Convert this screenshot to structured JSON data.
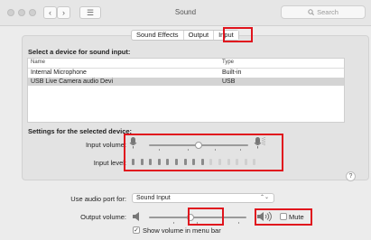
{
  "window": {
    "title": "Sound",
    "search_placeholder": "Search",
    "back_glyph": "‹",
    "forward_glyph": "›",
    "grid_glyph": "☰"
  },
  "tabs": [
    {
      "label": "Sound Effects",
      "selected": false
    },
    {
      "label": "Output",
      "selected": false
    },
    {
      "label": "Input",
      "selected": true
    }
  ],
  "input_section": {
    "heading": "Select a device for sound input:",
    "columns": {
      "name": "Name",
      "type": "Type"
    },
    "devices": [
      {
        "name": "Internal Microphone",
        "type": "Built-in",
        "selected": false
      },
      {
        "name": "USB  Live  Camera  audio  Devi",
        "type": "USB",
        "selected": true
      }
    ]
  },
  "settings": {
    "heading": "Settings for the selected device:",
    "input_volume_label": "Input volume:",
    "input_volume_fraction": 0.5,
    "input_level_label": "Input level:",
    "input_level_active_bars": 9,
    "input_level_total_bars": 15,
    "help_glyph": "?"
  },
  "bottom": {
    "audio_port_label": "Use audio port for:",
    "audio_port_value": "Sound Input",
    "output_volume_label": "Output volume:",
    "output_volume_fraction": 0.43,
    "mute_label": "Mute",
    "mute_checked": false,
    "show_volume_label": "Show volume in menu bar",
    "show_volume_checked": true,
    "check_glyph": "✓"
  },
  "colors": {
    "highlight": "#e0141d",
    "active_level": "#8a8a8a",
    "inactive_level": "#cfcfcf"
  },
  "icons": {
    "mic_low": "microphone-low-icon",
    "mic_high": "microphone-high-icon",
    "speaker_low": "speaker-low-icon",
    "speaker_high": "speaker-high-icon",
    "search": "search-icon"
  }
}
